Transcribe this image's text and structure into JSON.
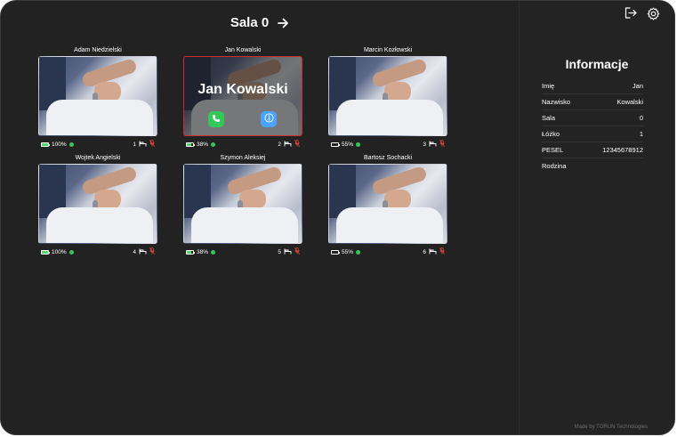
{
  "header": {
    "room_title": "Sala 0"
  },
  "tiles": [
    {
      "name": "Adam Niedzielski",
      "battery": "100%",
      "battery_level": 1.0,
      "bed": "1",
      "selected": false
    },
    {
      "name": "Jan Kowalski",
      "battery": "38%",
      "battery_level": 0.38,
      "bed": "2",
      "selected": true,
      "overlay_name": "Jan Kowalski"
    },
    {
      "name": "Marcin Kozłowski",
      "battery": "55%",
      "battery_level": 0.0,
      "bed": "3",
      "selected": false
    },
    {
      "name": "Wojtek Angielski",
      "battery": "100%",
      "battery_level": 1.0,
      "bed": "4",
      "selected": false
    },
    {
      "name": "Szymon Aleksiej",
      "battery": "38%",
      "battery_level": 0.38,
      "bed": "5",
      "selected": false
    },
    {
      "name": "Bartosz Sochacki",
      "battery": "55%",
      "battery_level": 0.0,
      "bed": "6",
      "selected": false
    }
  ],
  "info": {
    "title": "Informacje",
    "rows": [
      {
        "label": "Imię",
        "value": "Jan"
      },
      {
        "label": "Nazwisko",
        "value": "Kowalski"
      },
      {
        "label": "Sala",
        "value": "0"
      },
      {
        "label": "Łóżko",
        "value": "1"
      },
      {
        "label": "PESEL",
        "value": "12345678912"
      },
      {
        "label": "Rodzina",
        "value": ""
      }
    ]
  },
  "footer": {
    "text": "Made by TORUN Technologies"
  },
  "colors": {
    "background": "#222222",
    "accent_red": "#d22b2b",
    "status_green": "#34c759",
    "mic_red": "#e0453a"
  },
  "icons": [
    "arrow-right-icon",
    "logout-icon",
    "gear-icon",
    "battery-icon",
    "status-dot-icon",
    "bed-icon",
    "mic-muted-icon",
    "phone-icon",
    "info-icon"
  ]
}
